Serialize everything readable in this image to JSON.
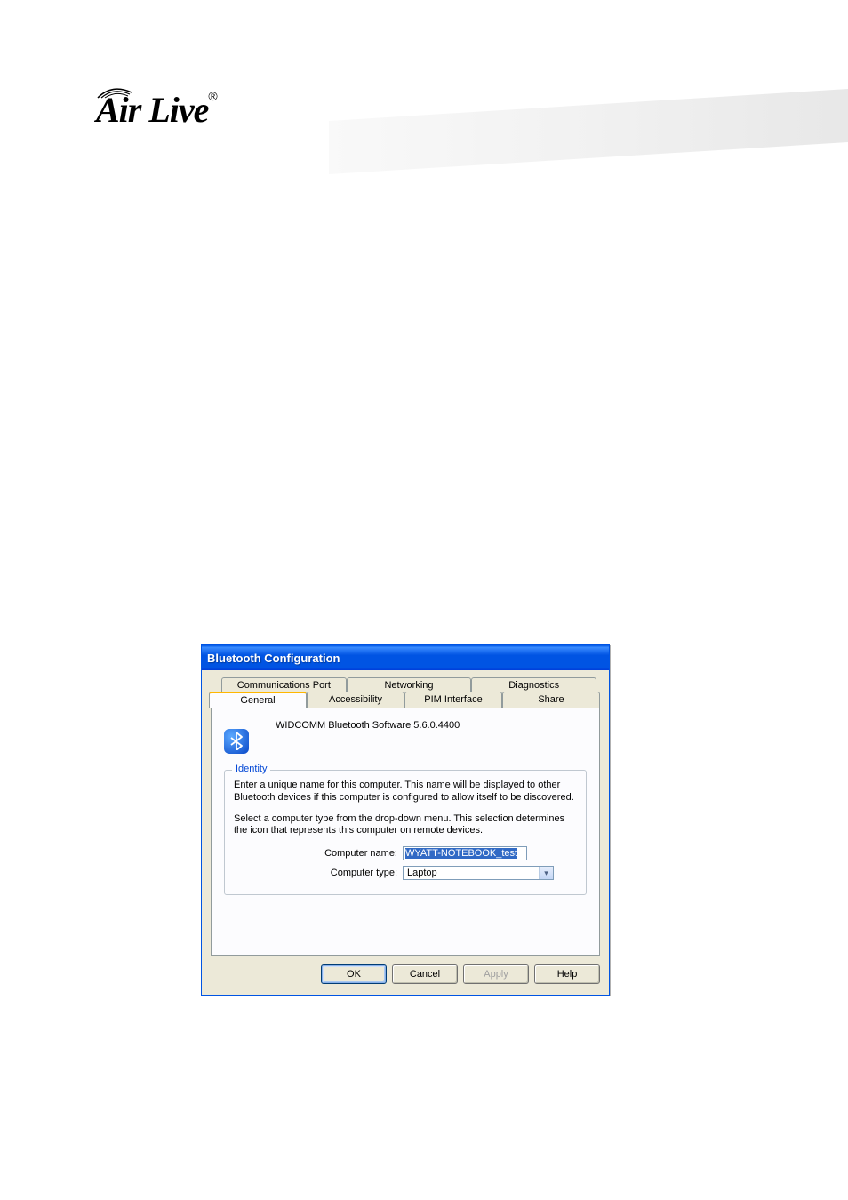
{
  "brand": {
    "name": "Air Live",
    "trademark": "®"
  },
  "dialog": {
    "title": "Bluetooth Configuration",
    "tabs_back": [
      "Communications Port",
      "Networking",
      "Diagnostics"
    ],
    "tabs_front": [
      "General",
      "Accessibility",
      "PIM Interface",
      "Share"
    ],
    "active_tab": "General",
    "software_label": "WIDCOMM Bluetooth Software 5.6.0.4400",
    "fieldset": {
      "legend": "Identity",
      "para1": "Enter a unique name for this computer.  This name will be displayed to other Bluetooth devices if this computer is configured to allow itself to be discovered.",
      "para2": "Select a computer type from the drop-down menu.  This selection determines the icon that represents this computer on remote devices.",
      "name_label": "Computer name:",
      "name_value": "WYATT-NOTEBOOK_test",
      "type_label": "Computer type:",
      "type_value": "Laptop"
    },
    "buttons": {
      "ok": "OK",
      "cancel": "Cancel",
      "apply": "Apply",
      "help": "Help"
    }
  }
}
